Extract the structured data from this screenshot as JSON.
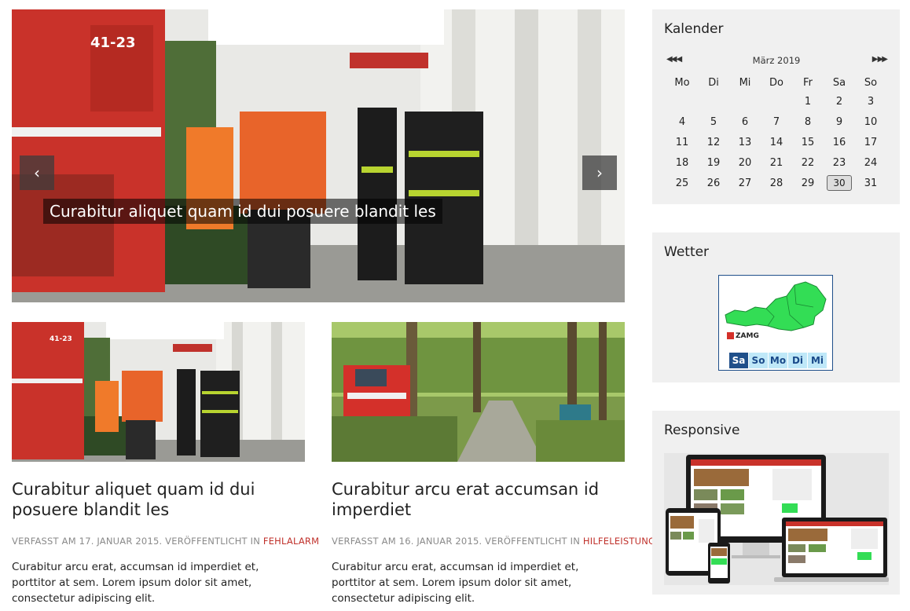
{
  "hero": {
    "caption": "Curabitur aliquet quam id dui posuere blandit les",
    "prev_icon": "‹",
    "next_icon": "›"
  },
  "articles": [
    {
      "title": "Curabitur aliquet quam id dui posuere blandit les",
      "meta_prefix": "VERFASST AM 17. JANUAR 2015. VERÖFFENTLICHT IN ",
      "category": "FEHLALARM",
      "excerpt": "Curabitur arcu erat, accumsan id imperdiet et, porttitor at sem. Lorem ipsum dolor sit amet, consectetur adipiscing elit."
    },
    {
      "title": "Curabitur arcu erat accumsan id imperdiet",
      "meta_prefix": "VERFASST AM 16. JANUAR 2015. VERÖFFENTLICHT IN ",
      "category": "HILFELEISTUNG",
      "excerpt": "Curabitur arcu erat, accumsan id imperdiet et, porttitor at sem. Lorem ipsum dolor sit amet, consectetur adipiscing elit."
    }
  ],
  "sidebar": {
    "calendar": {
      "title": "Kalender",
      "month": "März 2019",
      "prev_icon": "◀◀ ◀",
      "next_icon": "▶ ▶▶",
      "weekdays": [
        "Mo",
        "Di",
        "Mi",
        "Do",
        "Fr",
        "Sa",
        "So"
      ],
      "weeks": [
        [
          "",
          "",
          "",
          "",
          "1",
          "2",
          "3"
        ],
        [
          "4",
          "5",
          "6",
          "7",
          "8",
          "9",
          "10"
        ],
        [
          "11",
          "12",
          "13",
          "14",
          "15",
          "16",
          "17"
        ],
        [
          "18",
          "19",
          "20",
          "21",
          "22",
          "23",
          "24"
        ],
        [
          "25",
          "26",
          "27",
          "28",
          "29",
          "30",
          "31"
        ]
      ],
      "today": "30"
    },
    "weather": {
      "title": "Wetter",
      "logo": "ZAMG",
      "days": [
        "Sa",
        "So",
        "Mo",
        "Di",
        "Mi"
      ],
      "active_day": "Sa"
    },
    "responsive": {
      "title": "Responsive"
    }
  }
}
